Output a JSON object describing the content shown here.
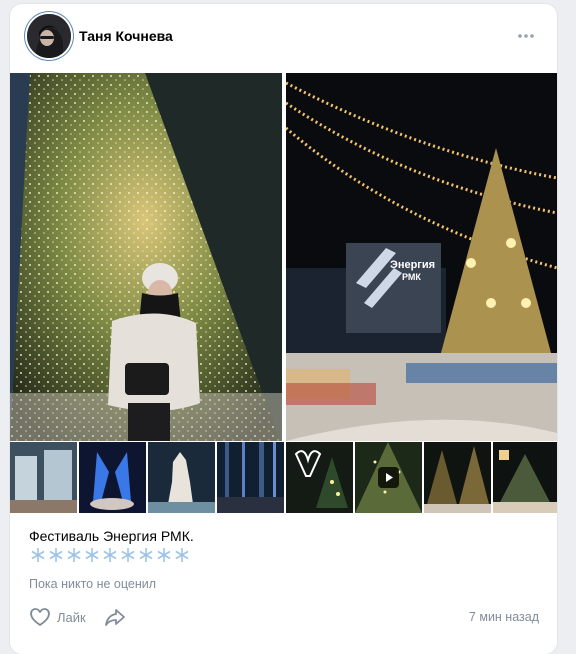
{
  "post": {
    "author": "Таня Кочнева",
    "caption": "Фестиваль Энергия РМК.",
    "snowflakes": [
      "❄️",
      "❄️",
      "❄️",
      "❄️",
      "❄️",
      "❄️",
      "❄️",
      "❄️",
      "❄️"
    ],
    "likes_info": "Пока никто не оценил",
    "like_label": "Лайк",
    "timestamp": "7 мин назад"
  },
  "photos": {
    "right_sign": [
      "Энергия",
      "РМК"
    ]
  },
  "icons": {
    "more": "more-horizontal-icon",
    "like": "heart-outline-icon",
    "share": "share-arrow-icon",
    "play": "play-icon"
  },
  "colors": {
    "meta_text": "#818c99",
    "card_bg": "#ffffff",
    "page_bg": "#eceef2",
    "snowflake": "#9ec3e6"
  }
}
